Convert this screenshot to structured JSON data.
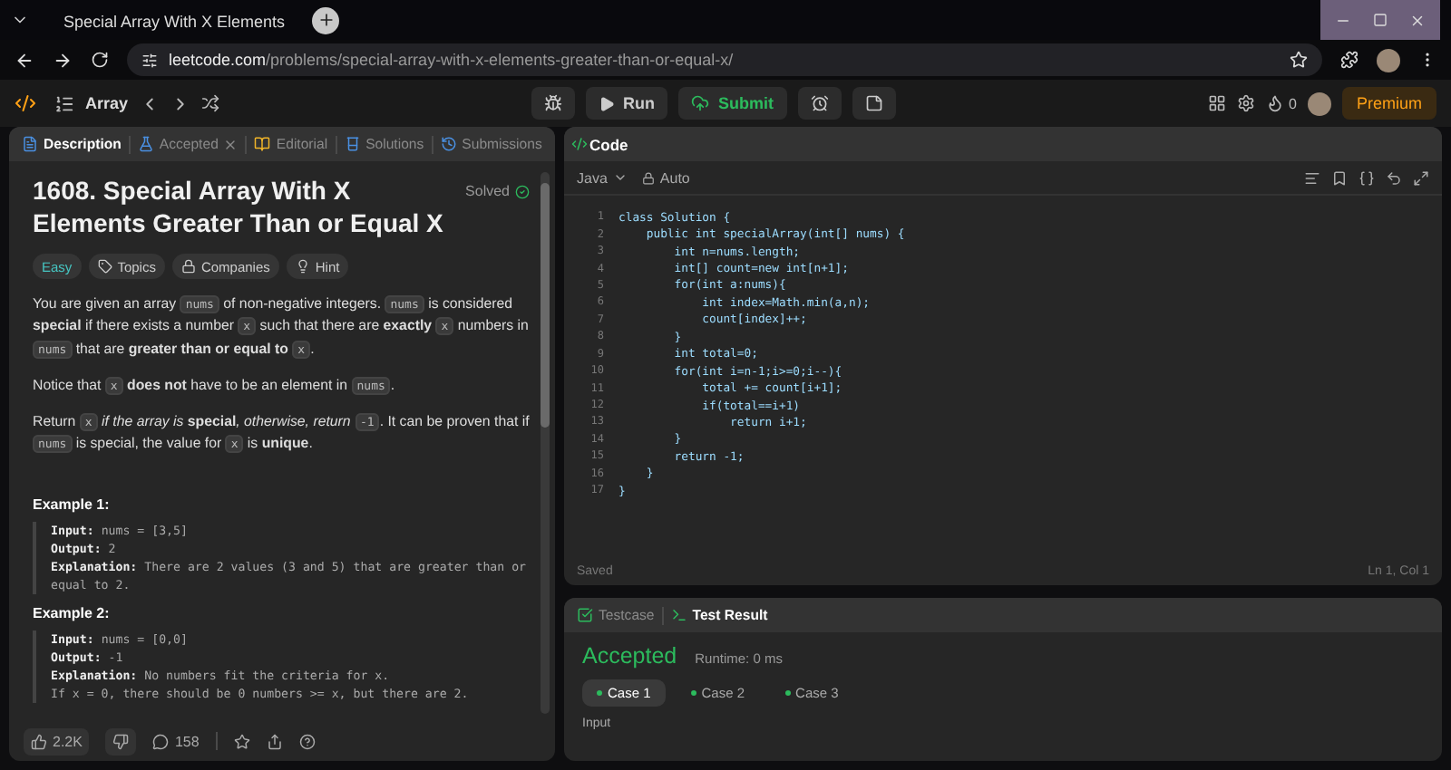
{
  "browser": {
    "tab_title": "Special Array With X Elements",
    "url_domain": "leetcode.com",
    "url_path": "/problems/special-array-with-x-elements-greater-than-or-equal-x/"
  },
  "nav": {
    "problem_list": "Array",
    "run": "Run",
    "submit": "Submit",
    "streak": "0",
    "premium": "Premium"
  },
  "left_tabs": [
    {
      "label": "Description",
      "selected": true,
      "closable": false
    },
    {
      "label": "Accepted",
      "selected": false,
      "closable": true
    },
    {
      "label": "Editorial",
      "selected": false,
      "closable": false
    },
    {
      "label": "Solutions",
      "selected": false,
      "closable": false
    },
    {
      "label": "Submissions",
      "selected": false,
      "closable": false
    }
  ],
  "problem": {
    "title": "1608. Special Array With X Elements Greater Than or Equal X",
    "status": "Solved",
    "tags": [
      {
        "kind": "difficulty",
        "label": "Easy"
      },
      {
        "kind": "topics",
        "label": "Topics"
      },
      {
        "kind": "companies",
        "label": "Companies"
      },
      {
        "kind": "hint",
        "label": "Hint"
      }
    ],
    "paragraphs": [
      [
        {
          "kind": "text",
          "text": "You are given an array "
        },
        {
          "kind": "code",
          "text": "nums"
        },
        {
          "kind": "text",
          "text": " of non-negative integers. "
        },
        {
          "kind": "code",
          "text": "nums"
        },
        {
          "kind": "text",
          "text": " is considered **special** if there exists a number "
        },
        {
          "kind": "code",
          "text": "x"
        },
        {
          "kind": "text",
          "text": " such that there are **exactly** "
        },
        {
          "kind": "code",
          "text": "x"
        },
        {
          "kind": "text",
          "text": " numbers in "
        },
        {
          "kind": "code",
          "text": "nums"
        },
        {
          "kind": "text",
          "text": " that are **greater than or equal to** "
        },
        {
          "kind": "code",
          "text": "x"
        },
        {
          "kind": "text",
          "text": "."
        }
      ],
      [
        {
          "kind": "text",
          "text": "Notice that "
        },
        {
          "kind": "code",
          "text": "x"
        },
        {
          "kind": "text",
          "text": " **does not** have to be an element in "
        },
        {
          "kind": "code",
          "text": "nums"
        },
        {
          "kind": "text",
          "text": "."
        }
      ],
      [
        {
          "kind": "text",
          "text": "Return "
        },
        {
          "kind": "code",
          "text": "x"
        },
        {
          "kind": "text",
          "text": " *if the array is* "
        },
        {
          "kind": "text",
          "text": "**special**"
        },
        {
          "kind": "text",
          "text": "*, otherwise, return* "
        },
        {
          "kind": "code",
          "text": "-1"
        },
        {
          "kind": "text",
          "text": ". It can be proven that if "
        },
        {
          "kind": "code",
          "text": "nums"
        },
        {
          "kind": "text",
          "text": " is special, the value for "
        },
        {
          "kind": "code",
          "text": "x"
        },
        {
          "kind": "text",
          "text": " is **unique**."
        }
      ]
    ],
    "examples": [
      {
        "title": "Example 1:",
        "lines": [
          {
            "label": "Input:",
            "value": "nums = [3,5]"
          },
          {
            "label": "Output:",
            "value": "2"
          },
          {
            "label": "Explanation:",
            "value": "There are 2 values (3 and 5) that are greater than or equal to 2."
          }
        ]
      },
      {
        "title": "Example 2:",
        "lines": [
          {
            "label": "Input:",
            "value": "nums = [0,0]"
          },
          {
            "label": "Output:",
            "value": "-1"
          },
          {
            "label": "Explanation:",
            "value": "No numbers fit the criteria for x."
          },
          {
            "value": "If x = 0, there should be 0 numbers >= x, but there are 2."
          }
        ]
      }
    ]
  },
  "footer": {
    "likes": "2.2K",
    "comments": "158"
  },
  "code_panel": {
    "title": "Code",
    "language": "Java",
    "mode": "Auto",
    "status": "Saved",
    "cursor": "Ln 1, Col 1",
    "lines": [
      {
        "number": "1",
        "text": "class Solution {"
      },
      {
        "number": "2",
        "text": "    public int specialArray(int[] nums) {"
      },
      {
        "number": "3",
        "text": "        int n=nums.length;"
      },
      {
        "number": "4",
        "text": "        int[] count=new int[n+1];"
      },
      {
        "number": "5",
        "text": "        for(int a:nums){"
      },
      {
        "number": "6",
        "text": "            int index=Math.min(a,n);"
      },
      {
        "number": "7",
        "text": "            count[index]++;"
      },
      {
        "number": "8",
        "text": "        }"
      },
      {
        "number": "9",
        "text": "        int total=0;"
      },
      {
        "number": "10",
        "text": "        for(int i=n-1;i>=0;i--){"
      },
      {
        "number": "11",
        "text": "            total += count[i+1];"
      },
      {
        "number": "12",
        "text": "            if(total==i+1)"
      },
      {
        "number": "13",
        "text": "                return i+1;"
      },
      {
        "number": "14",
        "text": "        }"
      },
      {
        "number": "15",
        "text": "        return -1;"
      },
      {
        "number": "16",
        "text": "    }"
      },
      {
        "number": "17",
        "text": "}"
      }
    ]
  },
  "result_panel": {
    "tabs": [
      {
        "label": "Testcase",
        "selected": false
      },
      {
        "label": "Test Result",
        "selected": true
      }
    ],
    "verdict": "Accepted",
    "runtime": "Runtime: 0 ms",
    "cases": [
      {
        "label": "Case 1",
        "selected": true
      },
      {
        "label": "Case 2",
        "selected": false
      },
      {
        "label": "Case 3",
        "selected": false
      }
    ],
    "input_label": "Input"
  }
}
